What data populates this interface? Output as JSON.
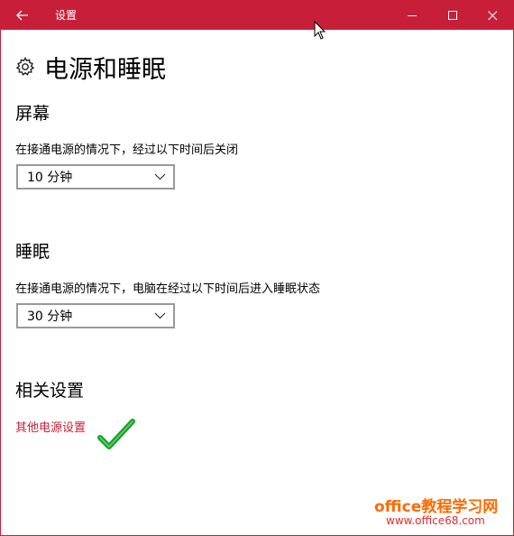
{
  "window": {
    "title": "设置",
    "colors": {
      "accent": "#c71f3a",
      "link": "#c71f3a"
    },
    "controls": [
      "back-arrow-icon",
      "minimize-icon",
      "maximize-icon",
      "close-icon"
    ]
  },
  "page": {
    "icon": "gear-icon",
    "title": "电源和睡眠"
  },
  "screen": {
    "heading": "屏幕",
    "description": "在接通电源的情况下，经过以下时间后关闭",
    "selected": "10 分钟"
  },
  "sleep": {
    "heading": "睡眠",
    "description": "在接通电源的情况下，电脑在经过以下时间后进入睡眠状态",
    "selected": "30 分钟"
  },
  "related": {
    "heading": "相关设置",
    "link": "其他电源设置"
  },
  "watermark": {
    "main": "office教程学习网",
    "url": "www.office68.com"
  }
}
